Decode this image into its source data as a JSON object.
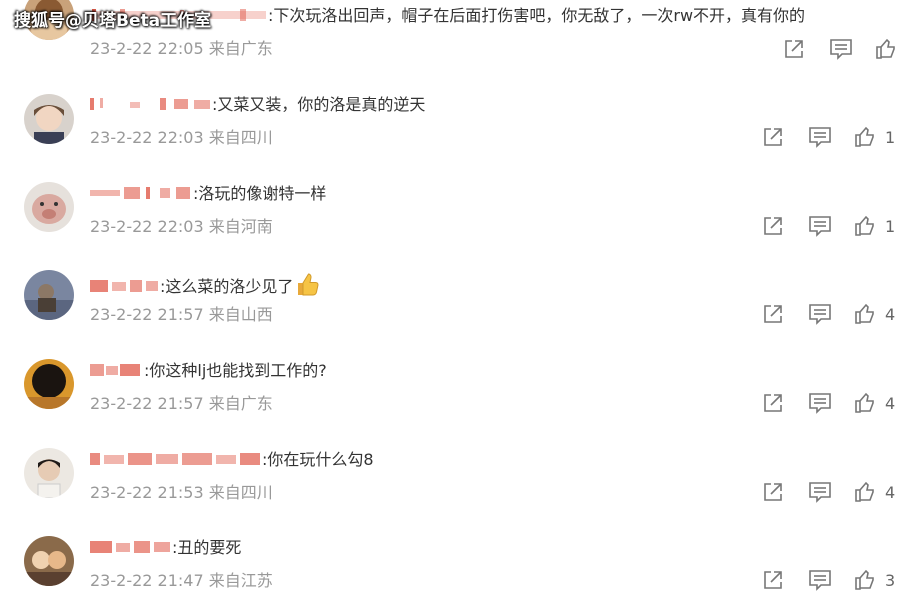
{
  "watermark": "搜狐号@贝塔Beta工作室",
  "colors": {
    "meta": "#999999",
    "icon": "#777777",
    "username_red": "#e05a4a",
    "text": "#333333"
  },
  "comments": [
    {
      "text": ":下次玩洛出回声，帽子在后面打伤害吧，你无敌了，一次rw不开，真有你的",
      "date": "23-2-22 22:05",
      "location": "来自广东",
      "likes": ""
    },
    {
      "text": ":又菜又装，你的洛是真的逆天",
      "date": "23-2-22 22:03",
      "location": "来自四川",
      "likes": "1"
    },
    {
      "text": ":洛玩的像谢特一样",
      "date": "23-2-22 22:03",
      "location": "来自河南",
      "likes": "1"
    },
    {
      "text": ":这么菜的洛少见了",
      "date": "23-2-22 21:57",
      "location": "来自山西",
      "likes": "4",
      "emoji": "thumbs-up-emoji"
    },
    {
      "text": ":你这种lj也能找到工作的?",
      "date": "23-2-22 21:57",
      "location": "来自广东",
      "likes": "4"
    },
    {
      "text": ":你在玩什么勾8",
      "date": "23-2-22 21:53",
      "location": "来自四川",
      "likes": "4"
    },
    {
      "text": ":丑的要死",
      "date": "23-2-22 21:47",
      "location": "来自江苏",
      "likes": "3"
    }
  ],
  "icons": {
    "share": "share-icon",
    "comment": "comment-icon",
    "like": "like-icon"
  }
}
